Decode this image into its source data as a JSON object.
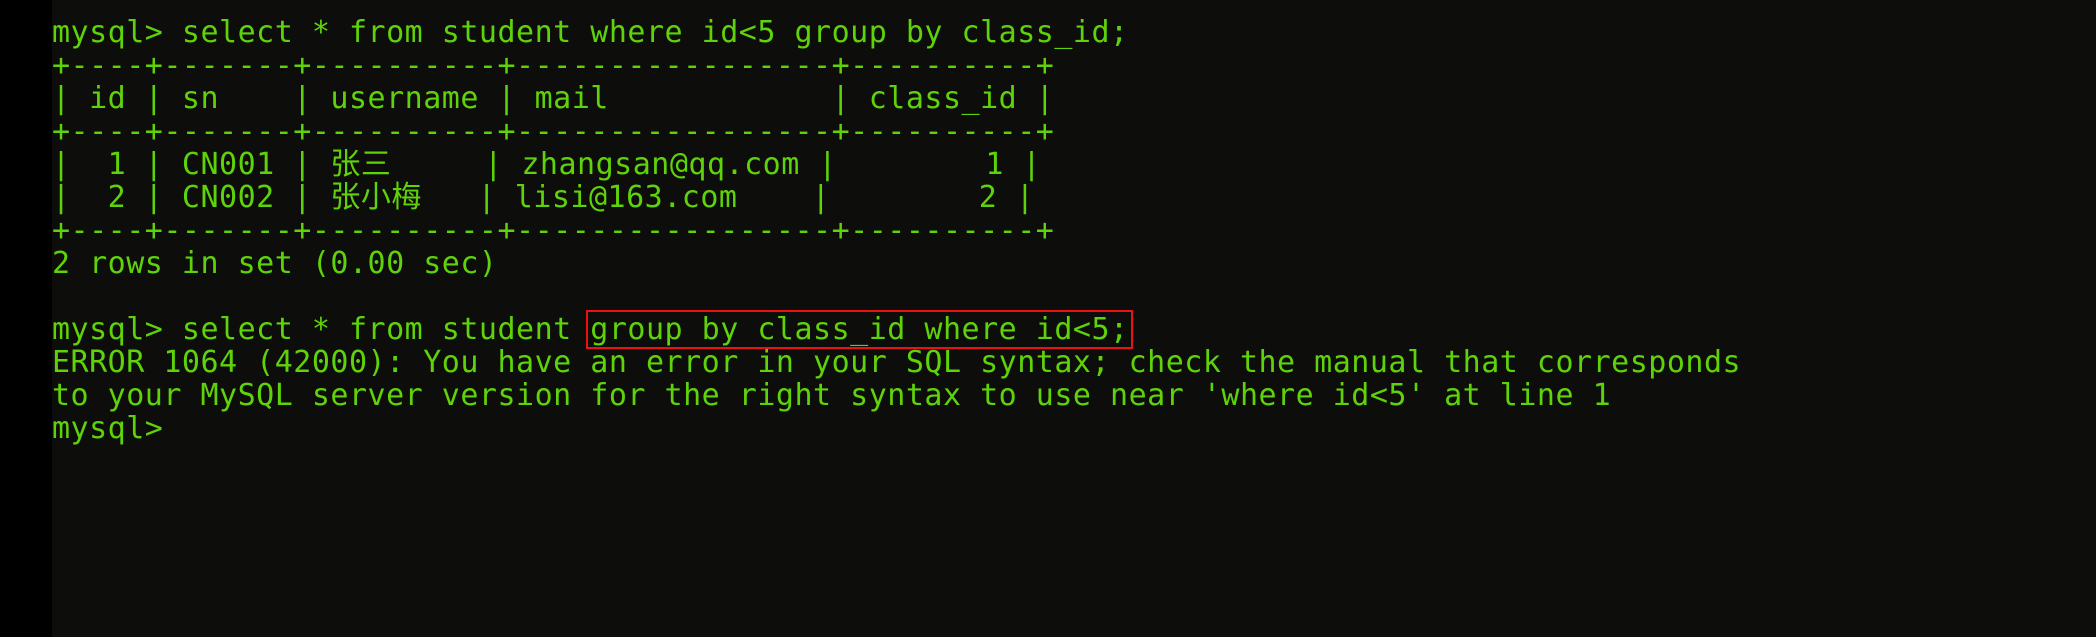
{
  "terminal": {
    "app": "mysql-client-terminal",
    "foreground_color": "#5fd30a",
    "background_color": "#0d0d0b",
    "gutter_color": "#000000",
    "annotation_color": "#ee1111"
  },
  "lines": {
    "l1_prompt": "mysql> select * from student where id<5 group by class_id;",
    "l2_rule_top": "+----+-------+----------+-----------------+----------+",
    "l3_header": "| id | sn    | username | mail            | class_id |",
    "l4_rule_mid": "+----+-------+----------+-----------------+----------+",
    "l5_row1": "|  1 | CN001 | 张三     | zhangsan@qq.com |        1 |",
    "l6_row2": "|  2 | CN002 | 张小梅   | lisi@163.com    |        2 |",
    "l7_rule_bottom": "+----+-------+----------+-----------------+----------+",
    "l8_result": "2 rows in set (0.00 sec)",
    "l9_blank": " ",
    "l10_prompt_prefix": "mysql> select * from student ",
    "l10_highlighted": "group by class_id where id<5;",
    "l11_error_part1": "ERROR 1064 (42000): You have an error in your SQL syntax; check the manual that corresponds",
    "l12_error_part2": "to your MySQL server version for the right syntax to use near 'where id<5' at line 1",
    "l13_prompt_final": "mysql>"
  },
  "query_result_table": {
    "columns": [
      "id",
      "sn",
      "username",
      "mail",
      "class_id"
    ],
    "rows": [
      {
        "id": "1",
        "sn": "CN001",
        "username": "张三",
        "mail": "zhangsan@qq.com",
        "class_id": "1"
      },
      {
        "id": "2",
        "sn": "CN002",
        "username": "张小梅",
        "mail": "lisi@163.com",
        "class_id": "2"
      }
    ],
    "row_count_text": "2 rows in set (0.00 sec)"
  },
  "error": {
    "code": "1064",
    "sqlstate": "42000",
    "near_token": "'where id<5'",
    "at_line": "1"
  }
}
